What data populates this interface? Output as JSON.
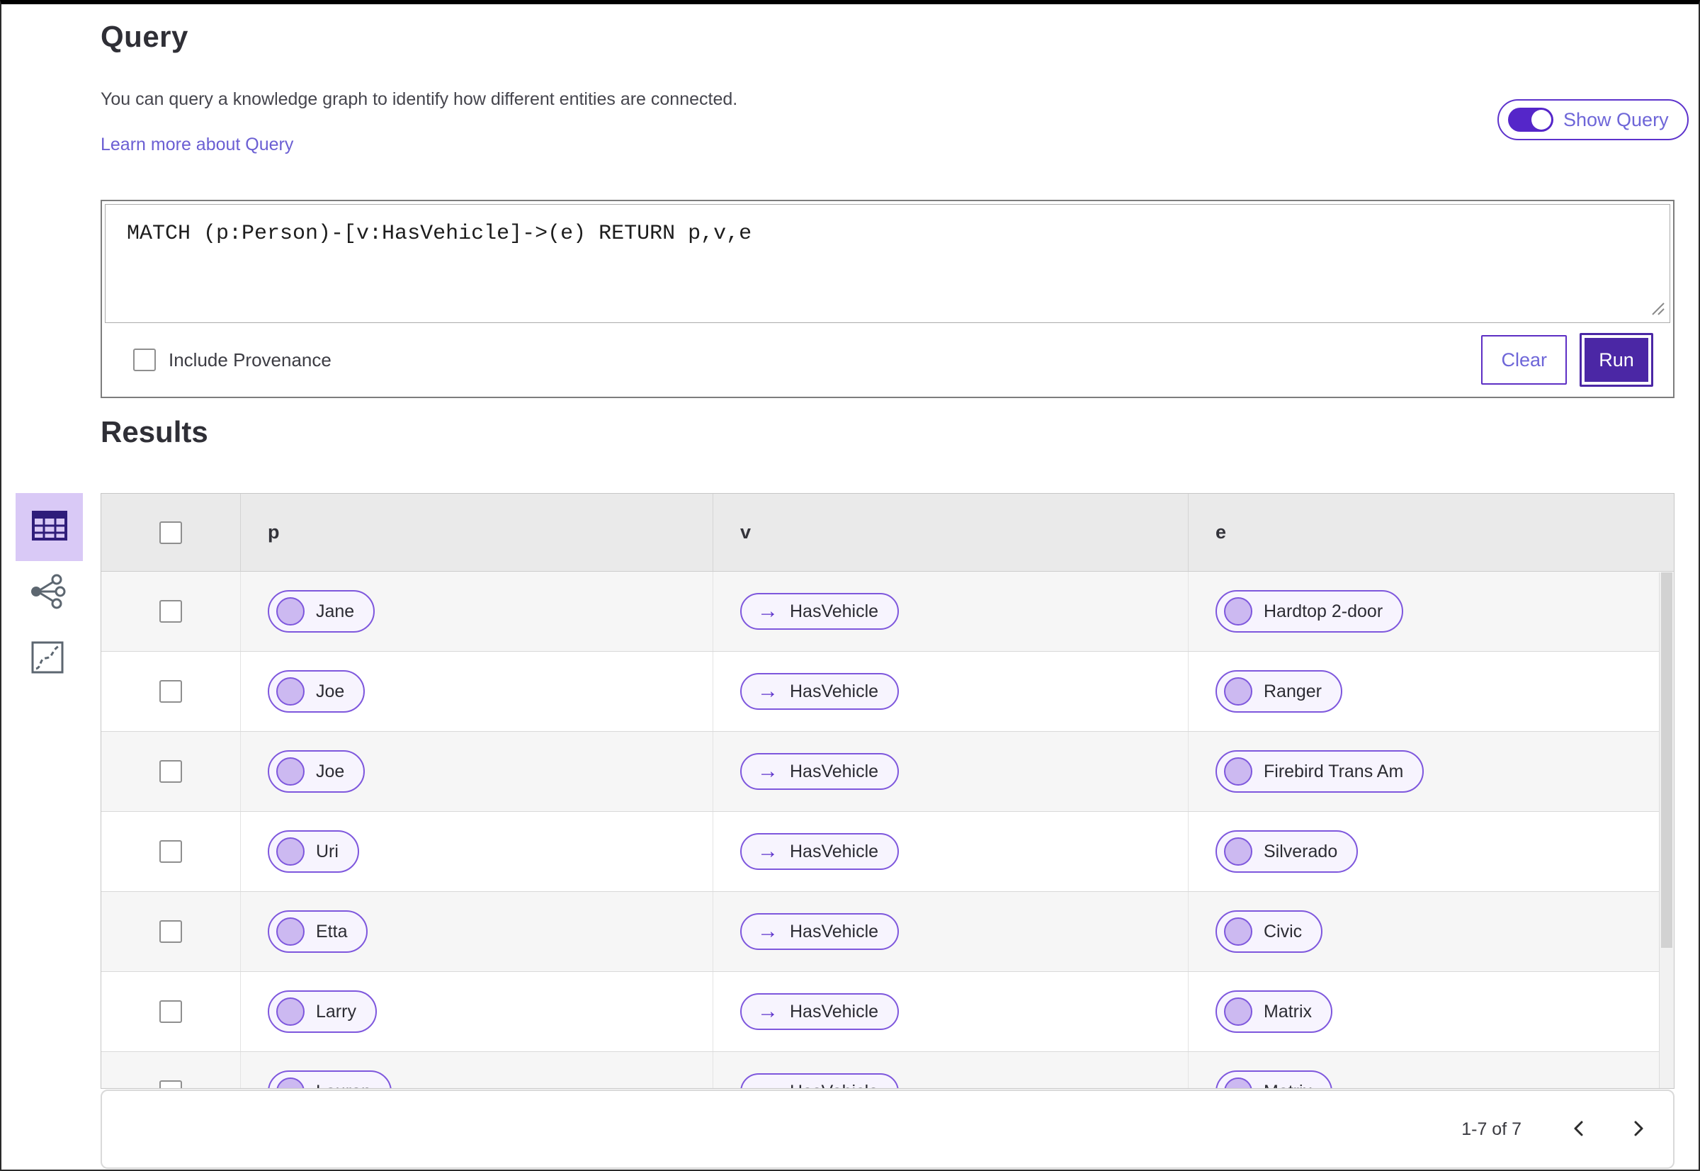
{
  "query_section": {
    "title": "Query",
    "description": "You can query a knowledge graph to identify how different entities are connected.",
    "link_label": "Learn more about Query",
    "show_query_label": "Show Query",
    "show_query_on": true,
    "query_text": "MATCH (p:Person)-[v:HasVehicle]->(e) RETURN p,v,e",
    "include_provenance_label": "Include Provenance",
    "include_provenance_checked": false,
    "clear_label": "Clear",
    "run_label": "Run"
  },
  "results_section": {
    "title": "Results",
    "columns": [
      "p",
      "v",
      "e"
    ],
    "rows": [
      {
        "p": "Jane",
        "v": "HasVehicle",
        "e": "Hardtop 2-door"
      },
      {
        "p": "Joe",
        "v": "HasVehicle",
        "e": "Ranger"
      },
      {
        "p": "Joe",
        "v": "HasVehicle",
        "e": "Firebird Trans Am"
      },
      {
        "p": "Uri",
        "v": "HasVehicle",
        "e": "Silverado"
      },
      {
        "p": "Etta",
        "v": "HasVehicle",
        "e": "Civic"
      },
      {
        "p": "Larry",
        "v": "HasVehicle",
        "e": "Matrix"
      },
      {
        "p": "Lauren",
        "v": "HasVehicle",
        "e": "Matrix"
      }
    ],
    "pagination": {
      "range_label": "1-7 of 7"
    }
  },
  "sidebar": {
    "views": [
      {
        "name": "table-view",
        "selected": true
      },
      {
        "name": "graph-view",
        "selected": false
      },
      {
        "name": "map-view",
        "selected": false
      }
    ]
  },
  "icons": {
    "edge_arrow": "→"
  },
  "colors": {
    "accent_purple": "#4b27a5",
    "toggle_purple": "#5526c9",
    "pill_border": "#7e57dd",
    "pill_fill": "#f7f4fe",
    "node_circle_fill": "#ccb9f1",
    "link": "#6b5fd3",
    "selected_tile_bg": "#d9c9f6",
    "header_bg": "#eaeaea",
    "stripe_bg": "#f6f6f6"
  }
}
